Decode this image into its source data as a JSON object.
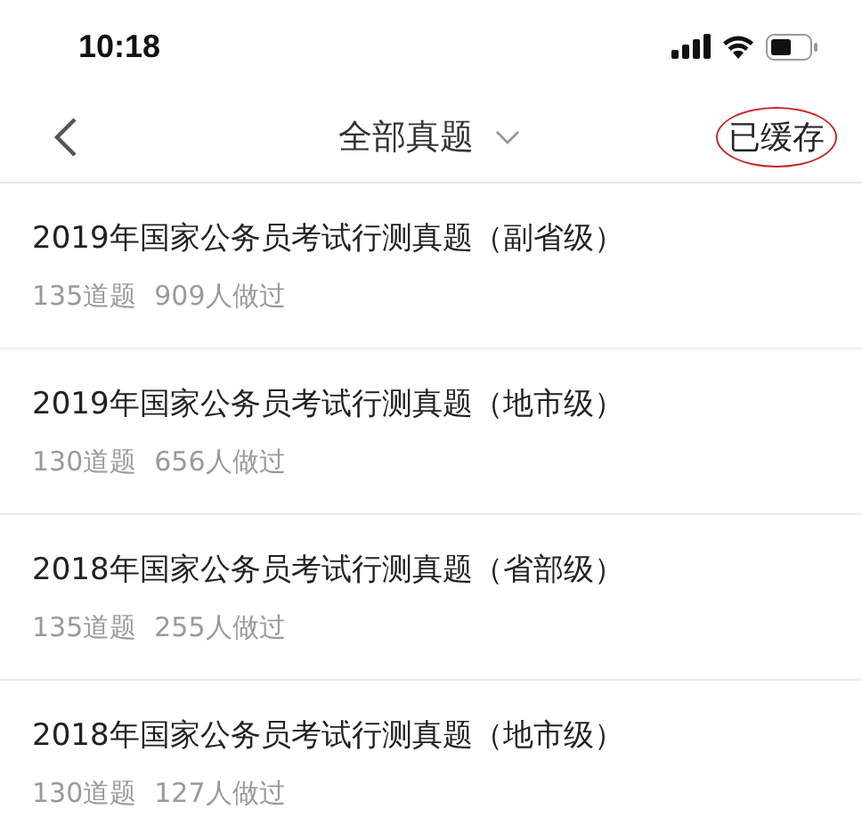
{
  "status_bar": {
    "time": "10:18"
  },
  "nav": {
    "title": "全部真题",
    "cached_button": {
      "label": "已缓存",
      "circled": true
    }
  },
  "papers": [
    {
      "title": "2019年国家公务员考试行测真题（副省级）",
      "questions": "135道题",
      "done": "909人做过"
    },
    {
      "title": "2019年国家公务员考试行测真题（地市级）",
      "questions": "130道题",
      "done": "656人做过"
    },
    {
      "title": "2018年国家公务员考试行测真题（省部级）",
      "questions": "135道题",
      "done": "255人做过"
    },
    {
      "title": "2018年国家公务员考试行测真题（地市级）",
      "questions": "130道题",
      "done": "127人做过"
    }
  ]
}
